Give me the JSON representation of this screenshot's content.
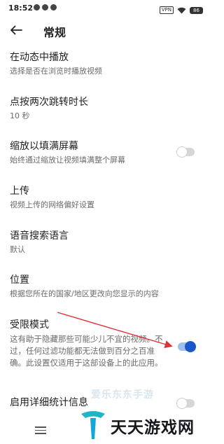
{
  "status_bar": {
    "time": "18:52",
    "vpn_label": "VPN",
    "battery_level": "86"
  },
  "header": {
    "title": "常规"
  },
  "settings": [
    {
      "title": "在动态中播放",
      "subtitle": "选择是否在浏览时播放视频"
    },
    {
      "title": "点按两次跳转时长",
      "subtitle": "10 秒"
    },
    {
      "title": "缩放以填满屏幕",
      "subtitle": "始终通过缩放让视频填满整个屏幕",
      "toggle": false
    },
    {
      "title": "上传",
      "subtitle": "视频上传的网络偏好设置"
    },
    {
      "title": "语音搜索语言",
      "subtitle": "默认"
    },
    {
      "title": "位置",
      "subtitle": "根据您所在的国家/地区更改向您显示的内容"
    },
    {
      "title": "受限模式",
      "subtitle": "这有助于隐藏那些可能少儿不宜的视频。不过，任何过滤功能都无法做到百分之百准确。此设置仅适用于这部设备上的此应用。",
      "toggle": true
    },
    {
      "title": "启用详细统计信息",
      "toggle": false
    }
  ],
  "watermark": {
    "top_text": "爱乐东东手游",
    "brand_text": "天天游戏网"
  },
  "colors": {
    "toggle_on_thumb": "#1a57c9",
    "toggle_on_track": "#9ec0f0",
    "toggle_off_track": "#d6d6d6",
    "annotation_arrow": "#e0303a"
  }
}
